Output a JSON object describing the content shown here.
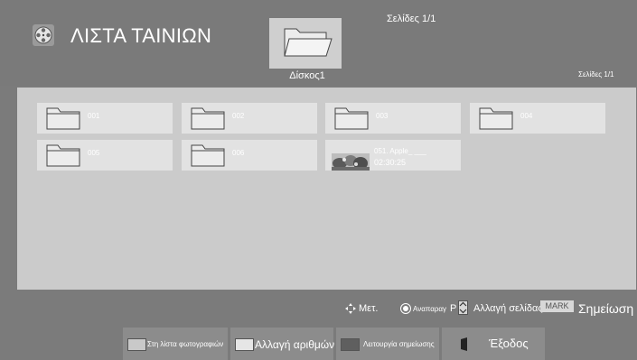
{
  "header": {
    "title": "ΛΙΣΤΑ ΤΑΙΝΙΩΝ",
    "page_top": "Σελίδες 1/1",
    "device_label": "Δίσκος1",
    "page_right": "Σελίδες  1/1",
    "app_icon": "film-reel-icon",
    "device_icon": "open-folder-icon"
  },
  "tiles": [
    {
      "type": "folder",
      "label": "001"
    },
    {
      "type": "folder",
      "label": "002"
    },
    {
      "type": "folder",
      "label": "003"
    },
    {
      "type": "folder",
      "label": "004"
    },
    {
      "type": "folder",
      "label": "005"
    },
    {
      "type": "folder",
      "label": "006"
    },
    {
      "type": "video",
      "name": "051. Apple_ ___",
      "duration": "02:30:25"
    }
  ],
  "help": {
    "move": "Μετ.",
    "play": "Αναπαραγ",
    "p_label": "P",
    "page_change": "Αλλαγή σελίδας",
    "mark_badge": "MARK",
    "mark_label": "Σημείωση"
  },
  "footer": {
    "photo_list": "Στη λίστα φωτογραφιών",
    "number_change": "Αλλαγή αριθμών",
    "mark_mode": "Λειτουργία σημείωσης",
    "exit": "Έξοδος"
  },
  "colors": {
    "background": "#7b7b7b",
    "content_panel": "#cbcbcb",
    "tile": "#e2e2e2",
    "footer_button": "#8c8c8c"
  }
}
